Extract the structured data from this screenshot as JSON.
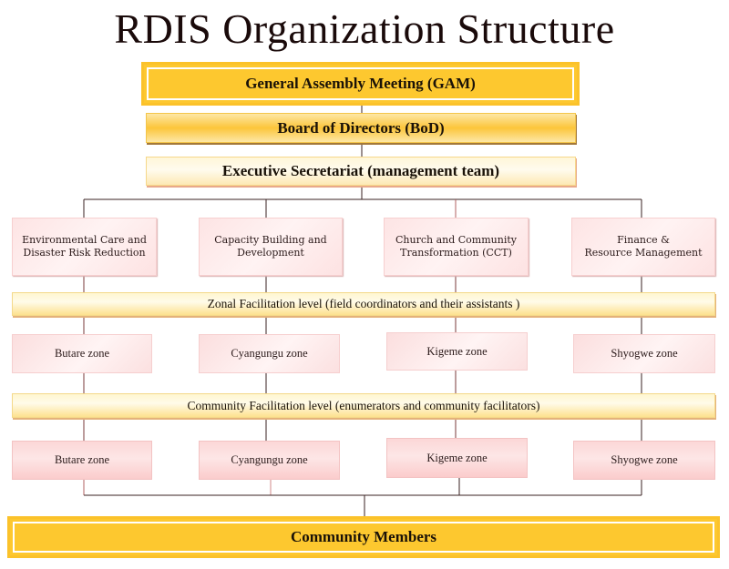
{
  "title": "RDIS Organization Structure",
  "governance": {
    "gam": "General Assembly Meeting (GAM)",
    "bod": "Board of Directors (BoD)",
    "executive": "Executive Secretariat (management team)"
  },
  "departments": [
    {
      "line1": "Environmental Care and",
      "line2": "Disaster Risk Reduction"
    },
    {
      "line1": "Capacity Building and",
      "line2": "Development"
    },
    {
      "line1": "Church and Community",
      "line2": "Transformation (CCT)"
    },
    {
      "line1": "Finance &",
      "line2": "Resource Management"
    }
  ],
  "zonal_level": {
    "label": "Zonal Facilitation level (field coordinators and their assistants )",
    "zones": [
      "Butare zone",
      "Cyangungu zone",
      "Kigeme zone",
      "Shyogwe zone"
    ]
  },
  "community_level": {
    "label": "Community Facilitation level (enumerators and community facilitators)",
    "zones": [
      "Butare zone",
      "Cyangungu zone",
      "Kigeme zone",
      "Shyogwe zone"
    ]
  },
  "community_members": "Community Members",
  "colors": {
    "gold": "#fdc82f",
    "pink": "#fde4e4",
    "connector": "#3a2222"
  }
}
